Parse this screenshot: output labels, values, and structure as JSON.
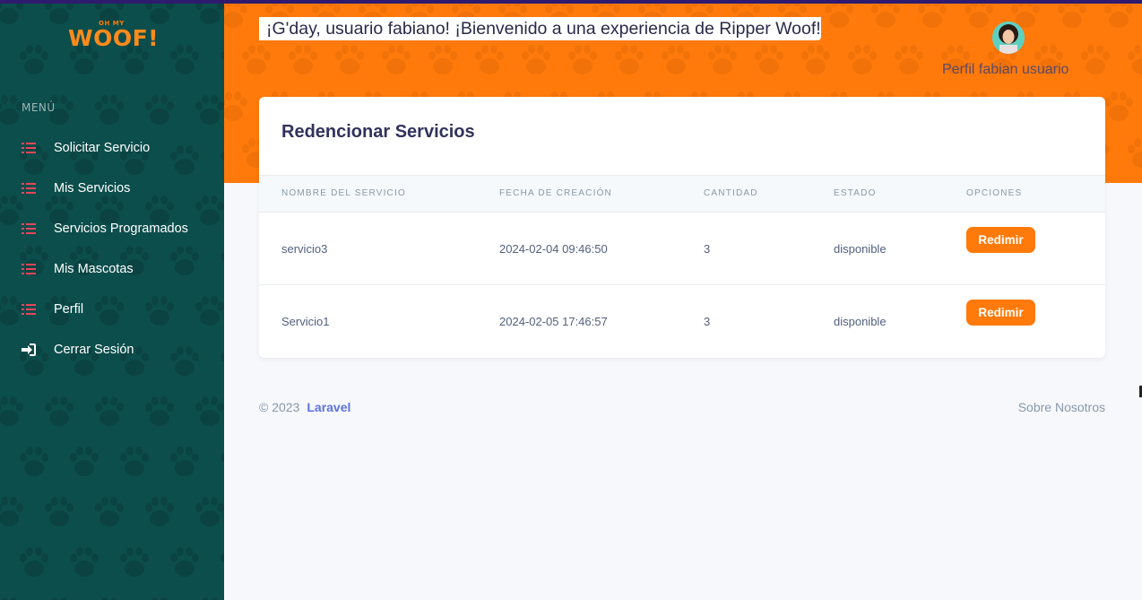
{
  "brand": {
    "logo_small": "OH MY",
    "logo_big": "WOOF!"
  },
  "sidebar": {
    "menu_title": "MENÚ",
    "items": [
      {
        "label": "Solicitar Servicio",
        "icon": "list-icon"
      },
      {
        "label": "Mis Servicios",
        "icon": "list-icon"
      },
      {
        "label": "Servicios Programados",
        "icon": "list-icon"
      },
      {
        "label": "Mis Mascotas",
        "icon": "list-icon"
      },
      {
        "label": "Perfil",
        "icon": "list-icon"
      },
      {
        "label": "Cerrar Sesión",
        "icon": "sign-in-icon"
      }
    ]
  },
  "header": {
    "greeting": "¡G'day, usuario fabiano! ¡Bienvenido a una experiencia de Ripper Woof!",
    "profile_label": "Perfil fabian usuario"
  },
  "card": {
    "title": "Redencionar Servicios",
    "columns": [
      "NOMBRE DEL SERVICIO",
      "FECHA DE CREACIÓN",
      "CANTIDAD",
      "ESTADO",
      "OPCIONES"
    ],
    "rows": [
      {
        "nombre": "servicio3",
        "fecha": "2024-02-04 09:46:50",
        "cantidad": "3",
        "estado": "disponible",
        "accion": "Redimir"
      },
      {
        "nombre": "Servicio1",
        "fecha": "2024-02-05 17:46:57",
        "cantidad": "3",
        "estado": "disponible",
        "accion": "Redimir"
      }
    ]
  },
  "footer": {
    "copyright": "© 2023",
    "brand": "Laravel",
    "about": "Sobre Nosotros"
  },
  "colors": {
    "sidebar": "#0c4e4c",
    "header": "#ff7a0a",
    "accent": "#ff7a0a",
    "link": "#5e72e4",
    "menu_icon": "#e8455a"
  }
}
